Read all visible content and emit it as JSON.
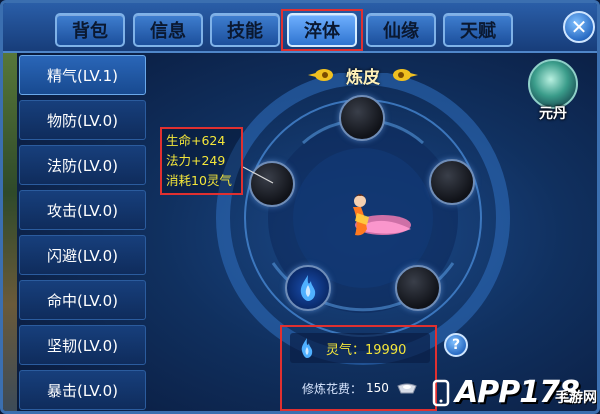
{
  "tabs": [
    {
      "label": "背包",
      "active": false
    },
    {
      "label": "信息",
      "active": false
    },
    {
      "label": "技能",
      "active": false
    },
    {
      "label": "淬体",
      "active": true
    },
    {
      "label": "仙缘",
      "active": false
    },
    {
      "label": "天赋",
      "active": false
    }
  ],
  "close_icon": "close-icon",
  "stats": [
    {
      "label": "精气(LV.1)",
      "active": true
    },
    {
      "label": "物防(LV.0)",
      "active": false
    },
    {
      "label": "法防(LV.0)",
      "active": false
    },
    {
      "label": "攻击(LV.0)",
      "active": false
    },
    {
      "label": "闪避(LV.0)",
      "active": false
    },
    {
      "label": "命中(LV.0)",
      "active": false
    },
    {
      "label": "坚韧(LV.0)",
      "active": false
    },
    {
      "label": "暴击(LV.0)",
      "active": false
    }
  ],
  "title": "炼皮",
  "yuandan": {
    "label": "元丹"
  },
  "tooltip": {
    "lines": [
      "生命+624",
      "法力+249",
      "消耗10灵气"
    ]
  },
  "lingqi": {
    "text": "灵气：19990"
  },
  "cost": {
    "label": "修炼花费：",
    "value": "150"
  },
  "help": {
    "label": "?"
  },
  "watermark": {
    "brand": "APP178",
    "site": "手游网"
  },
  "colors": {
    "highlight_text": "#f4e63a",
    "annotation_box": "#e03030",
    "panel_blue": "#173f7c"
  }
}
